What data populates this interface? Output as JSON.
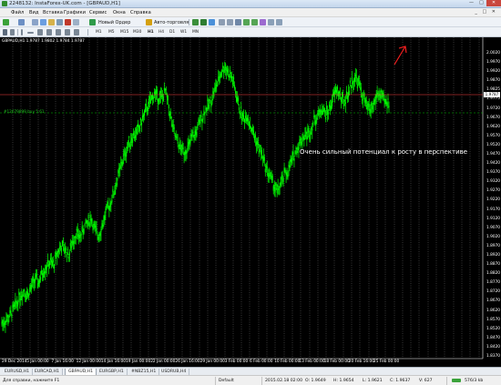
{
  "window": {
    "title": "2248132: InstaForex-UK.com - [GBPAUD,H1]",
    "min": "—",
    "max": "□",
    "close": "✕"
  },
  "menu": [
    "Файл",
    "Вид",
    "Вставка",
    "Графики",
    "Сервис",
    "Окна",
    "Справка"
  ],
  "toolbar": {
    "new_order": "Новый Ордер",
    "autotrade": "Авто-торговля"
  },
  "timeframes": [
    "M1",
    "M5",
    "M15",
    "M30",
    "H1",
    "H4",
    "D1",
    "W1",
    "MN"
  ],
  "chart": {
    "symbol_line": "GBPAUD,H1  1.9787 1.9802 1.9784 1.9787",
    "order_label": "#12679899 buy 5.61",
    "annotation": "Очень сильный потенциал к росту в перспективе",
    "bid_tag": "1.9787",
    "colors": {
      "candles": "#00ff00",
      "bid_line": "#ff4040",
      "order_line": "#00c000",
      "arrow": "#ff2020"
    },
    "price_labels": [
      "2.0020",
      "1.9970",
      "1.9920",
      "1.9870",
      "1.9825",
      "1.9775",
      "1.9720",
      "1.9670",
      "1.9620",
      "1.9570",
      "1.9520",
      "1.9470",
      "1.9420",
      "1.9370",
      "1.9320",
      "1.9270",
      "1.9220",
      "1.9170",
      "1.9120",
      "1.9070",
      "1.9020",
      "1.8970",
      "1.8920",
      "1.8870",
      "1.8820",
      "1.8770",
      "1.8720",
      "1.8670",
      "1.8620",
      "1.8570",
      "1.8520",
      "1.8470",
      "1.8420",
      "1.8370"
    ],
    "time_labels": [
      "29 Dec 2014",
      "5 Jan 00:00",
      "7 Jan 16:00",
      "12 Jan 00:00",
      "14 Jan 16:00",
      "19 Jan 00:00",
      "22 Jan 00:00",
      "26 Jan 16:00",
      "29 Jan 00:00",
      "3 Feb 00:00",
      "6 Feb 00:00",
      "10 Feb 00:00",
      "13 Feb 00:00",
      "18 Feb 00:00",
      "20 Feb 16:00",
      "25 Feb 00:00"
    ],
    "trend": [
      48,
      50,
      54,
      62,
      70,
      78,
      83,
      79,
      88,
      96,
      93,
      104,
      110,
      114,
      112,
      126,
      132,
      129,
      122,
      138,
      146,
      142,
      152,
      158,
      163,
      150,
      144,
      155,
      170,
      178,
      190,
      205,
      220,
      232,
      244,
      252,
      256,
      262,
      274,
      284,
      292,
      300,
      296,
      296,
      302,
      282,
      260,
      248,
      240,
      236,
      240,
      250,
      256,
      266,
      276,
      284,
      290,
      302,
      312,
      324,
      330,
      322,
      316,
      298,
      281,
      272,
      276,
      262,
      252,
      240,
      232,
      218,
      210,
      200,
      192,
      200,
      212,
      214,
      228,
      236,
      246,
      252,
      255,
      260,
      272,
      276,
      284,
      278,
      282,
      296,
      304,
      296,
      290,
      300,
      312,
      318,
      310,
      296,
      286,
      282,
      289,
      300,
      296,
      290,
      290
    ]
  },
  "tabs": [
    "EURUSD,H1",
    "EURCAD,H1",
    "GBPAUD,H1",
    "EURGBP,H1",
    "#NBZ15,H1",
    "USDRUB,H4"
  ],
  "active_tab": 2,
  "status": {
    "help": "Для справки, нажмите F1",
    "profile": "Default",
    "time": "2015.02.18 02:00",
    "open": "O: 1.9649",
    "high": "H: 1.9654",
    "low": "L: 1.9621",
    "close": "C: 1.9637",
    "volume": "V: 627",
    "traffic": "576/3 kb"
  }
}
